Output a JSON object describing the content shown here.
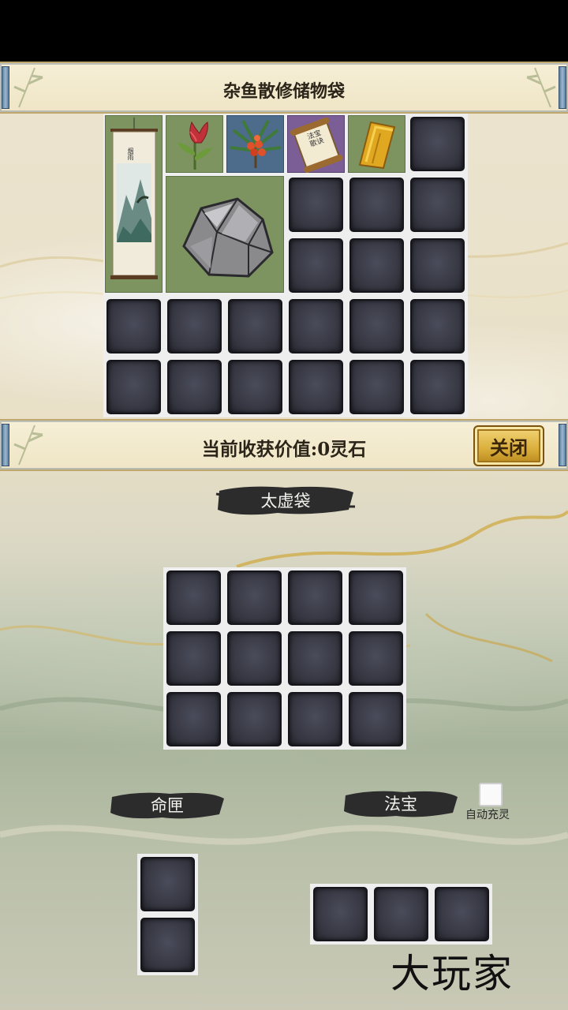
{
  "storage_bag": {
    "title": "杂鱼散修储物袋",
    "items": [
      {
        "name": "landscape-scroll-painting",
        "label": "烟雨"
      },
      {
        "name": "red-herb"
      },
      {
        "name": "fruit-branch"
      },
      {
        "name": "treasure-scroll",
        "label": "法宝歌诀"
      },
      {
        "name": "golden-paper"
      },
      {
        "name": "grey-ore-stone"
      }
    ]
  },
  "value_bar": {
    "label": "当前收获价值:0灵石",
    "close_label": "关闭"
  },
  "taixu_bag": {
    "title": "太虚袋"
  },
  "fate_box": {
    "title": "命匣"
  },
  "treasure": {
    "title": "法宝",
    "auto_charge_label": "自动充灵",
    "auto_charge_checked": false
  },
  "watermark": {
    "text": "大玩家"
  },
  "colors": {
    "slot_dark": "#34353f",
    "banner": "#f6efd6",
    "close_button": "#d9ad3a"
  }
}
